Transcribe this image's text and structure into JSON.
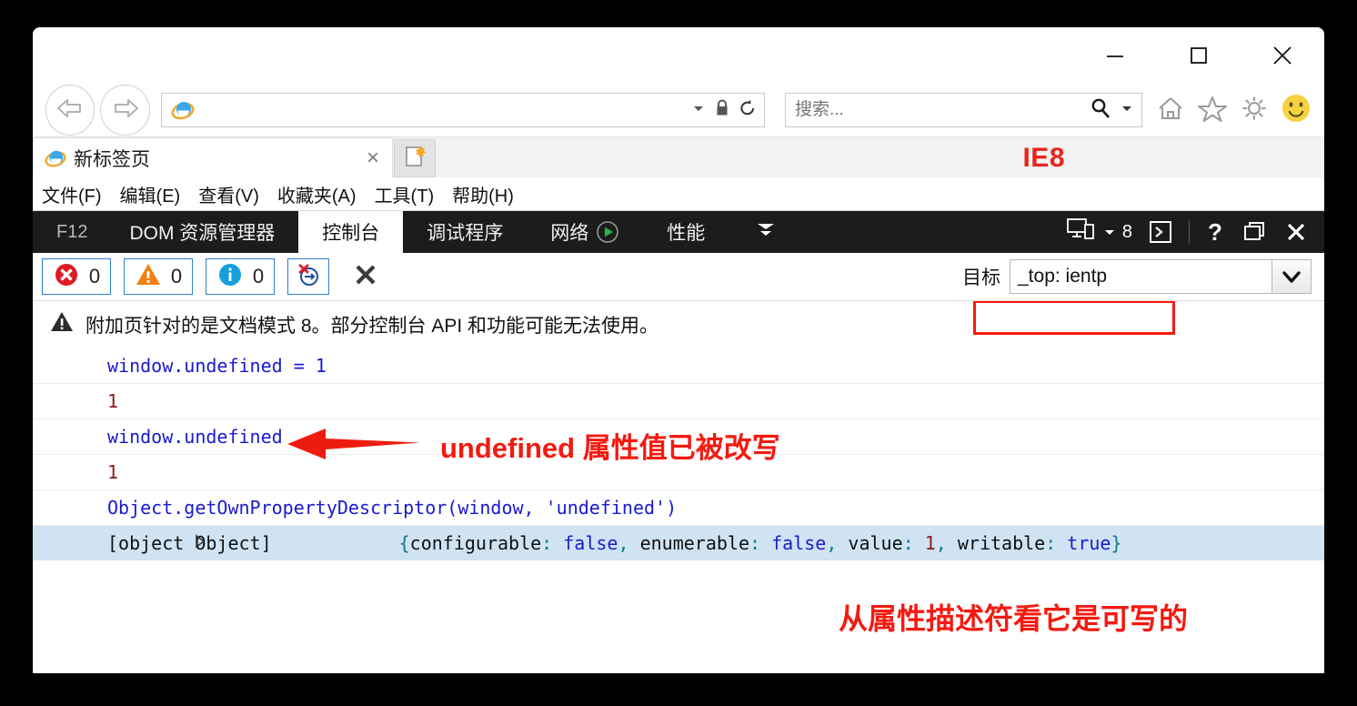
{
  "window": {
    "controls": {
      "minimize": "minimize-icon",
      "maximize": "maximize-icon",
      "close": "close-icon"
    }
  },
  "nav": {
    "back": "back-arrow-icon",
    "forward": "forward-arrow-icon",
    "address_value": "",
    "address_placeholder": "",
    "address_icons": [
      "chevron-down-icon",
      "lock-icon",
      "refresh-icon"
    ],
    "search_value": "",
    "search_placeholder": "搜索...",
    "tool_icons": [
      "home-icon",
      "favorites-star-icon",
      "settings-gear-icon",
      "smiley-icon"
    ]
  },
  "tabs": {
    "items": [
      {
        "title": "新标签页",
        "favicon": "ie-logo-icon",
        "close": "×"
      }
    ],
    "new_tab": "new-tab-icon",
    "watermark": "IE8"
  },
  "menubar": {
    "items": [
      "文件(F)",
      "编辑(E)",
      "查看(V)",
      "收藏夹(A)",
      "工具(T)",
      "帮助(H)"
    ]
  },
  "devtools": {
    "f12_label": "F12",
    "tabs": [
      {
        "label": "DOM 资源管理器",
        "active": false
      },
      {
        "label": "控制台",
        "active": true
      },
      {
        "label": "调试程序",
        "active": false
      },
      {
        "label": "网络",
        "active": false,
        "icon": "play-record-icon"
      },
      {
        "label": "性能",
        "active": false
      },
      {
        "label": "",
        "active": false,
        "icon": "double-chevron-down-icon"
      }
    ],
    "doc_mode": "8",
    "doc_mode_icon": "device-emulation-icon",
    "console_icon": "console-prompt-icon",
    "help_icon": "help-question-icon",
    "dock_icon": "undock-window-icon",
    "close_icon": "close-devtools-icon"
  },
  "console_toolbar": {
    "errors": {
      "icon": "error-icon",
      "count": "0"
    },
    "warnings": {
      "icon": "warning-icon",
      "count": "0"
    },
    "infos": {
      "icon": "info-icon",
      "count": "0"
    },
    "clear_on_navigate": "clear-on-navigate-icon",
    "clear_console": "clear-console-icon",
    "target_label": "目标",
    "target_value": "_top: ientp",
    "target_arrow": "chevron-down-icon"
  },
  "console": {
    "notice": {
      "icon": "warning-triangle-icon",
      "text": "附加页针对的是文档模式 8。部分控制台 API 和功能可能无法使用。"
    },
    "rows": [
      {
        "kind": "input",
        "text": "window.undefined = 1"
      },
      {
        "kind": "output",
        "text": "1"
      },
      {
        "kind": "input",
        "text": "window.undefined"
      },
      {
        "kind": "output",
        "text": "1"
      },
      {
        "kind": "input",
        "text": "Object.getOwnPropertyDescriptor(window, 'undefined')"
      }
    ],
    "object_row": {
      "expander": "expand-triangle-icon",
      "label": "[object Object]",
      "brace_open": "{",
      "props": [
        {
          "key": "configurable",
          "sep": ": ",
          "value": "false",
          "type": "bool"
        },
        {
          "key": "enumerable",
          "sep": ": ",
          "value": "false",
          "type": "bool"
        },
        {
          "key": "value",
          "sep": ": ",
          "value": "1",
          "type": "num"
        }
      ],
      "highlighted": {
        "key": "writable",
        "sep": ": ",
        "value": "true",
        "brace_close": "}"
      },
      "separator": ", "
    }
  },
  "annotations": {
    "arrow": "left-pointing-arrow",
    "note_top": "undefined 属性值已被改写",
    "note_bottom": "从属性描述符看它是可写的",
    "highlight_color": "#f41a10"
  }
}
